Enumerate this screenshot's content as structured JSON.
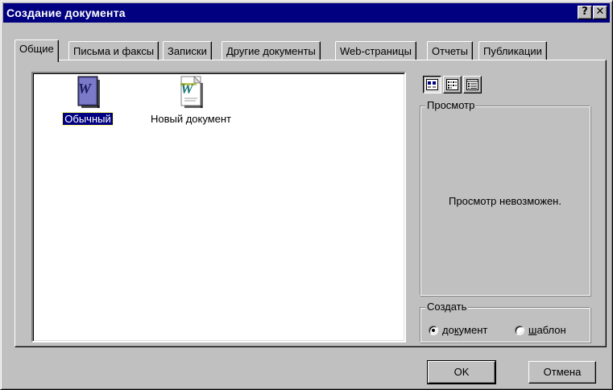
{
  "window": {
    "title": "Создание документа",
    "help_button": "?",
    "close_button": "✕"
  },
  "tabs": [
    {
      "label": "Общие",
      "active": true
    },
    {
      "label": "Письма и факсы",
      "active": false
    },
    {
      "label": "Записки",
      "active": false
    },
    {
      "label": "Другие документы",
      "active": false
    },
    {
      "label": "Web-страницы",
      "active": false
    },
    {
      "label": "Отчеты",
      "active": false
    },
    {
      "label": "Публикации",
      "active": false
    }
  ],
  "documents": [
    {
      "label": "Обычный",
      "icon": "word-template-icon",
      "selected": true
    },
    {
      "label": "Новый документ",
      "icon": "word-document-icon",
      "selected": false
    }
  ],
  "view_buttons": [
    {
      "name": "large-icons-view",
      "pressed": true
    },
    {
      "name": "list-view",
      "pressed": false
    },
    {
      "name": "details-view",
      "pressed": false
    }
  ],
  "preview": {
    "legend": "Просмотр",
    "message": "Просмотр невозможен."
  },
  "create": {
    "legend": "Создать",
    "options": [
      {
        "prefix": "до",
        "accel": "к",
        "suffix": "умент",
        "selected": true
      },
      {
        "prefix": "",
        "accel": "ш",
        "suffix": "аблон",
        "selected": false
      }
    ]
  },
  "buttons": {
    "ok": "OK",
    "cancel": "Отмена"
  },
  "colors": {
    "titlebar": "#000080",
    "face": "#c0c0c0",
    "selection": "#000080"
  }
}
